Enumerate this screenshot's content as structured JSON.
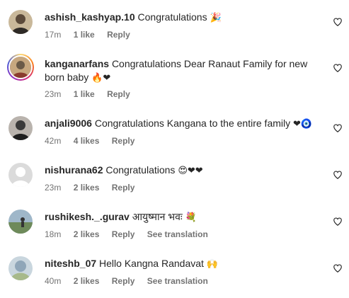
{
  "comments": [
    {
      "username": "ashish_kashyap.10",
      "text": "Congratulations",
      "emoji": "🎉",
      "time": "17m",
      "likes": "1 like",
      "reply": "Reply",
      "avatar_color": "#5b4a3a"
    },
    {
      "username": "kanganarfans",
      "text": "Congratulations Dear Ranaut Family for new born baby",
      "emoji": "🔥❤",
      "time": "23m",
      "likes": "1 like",
      "reply": "Reply",
      "avatar_color": "#6b5a48"
    },
    {
      "username": "anjali9006",
      "text": "Congratulations Kangana to the entire family",
      "emoji": "❤🧿",
      "time": "42m",
      "likes": "4 likes",
      "reply": "Reply",
      "avatar_color": "#3a3a3a"
    },
    {
      "username": "nishurana62",
      "text": "Congratulations",
      "emoji": "😍❤❤",
      "time": "23m",
      "likes": "2 likes",
      "reply": "Reply",
      "avatar_color": "#dbdbdb"
    },
    {
      "username": "rushikesh._.gurav",
      "text": "आयुष्मान भवः",
      "emoji": "💐",
      "time": "18m",
      "likes": "2 likes",
      "reply": "Reply",
      "translation": "See translation",
      "avatar_color": "#6e8a5a"
    },
    {
      "username": "niteshb_07",
      "text": "Hello Kangna Randavat",
      "emoji": "🙌",
      "time": "40m",
      "likes": "2 likes",
      "reply": "Reply",
      "translation": "See translation",
      "avatar_color": "#8fa6b8"
    }
  ],
  "colors": {
    "text": "#262626",
    "secondary": "#737373",
    "heart_red": "#ed4956"
  },
  "icons": {
    "like": "heart-outline-icon"
  }
}
